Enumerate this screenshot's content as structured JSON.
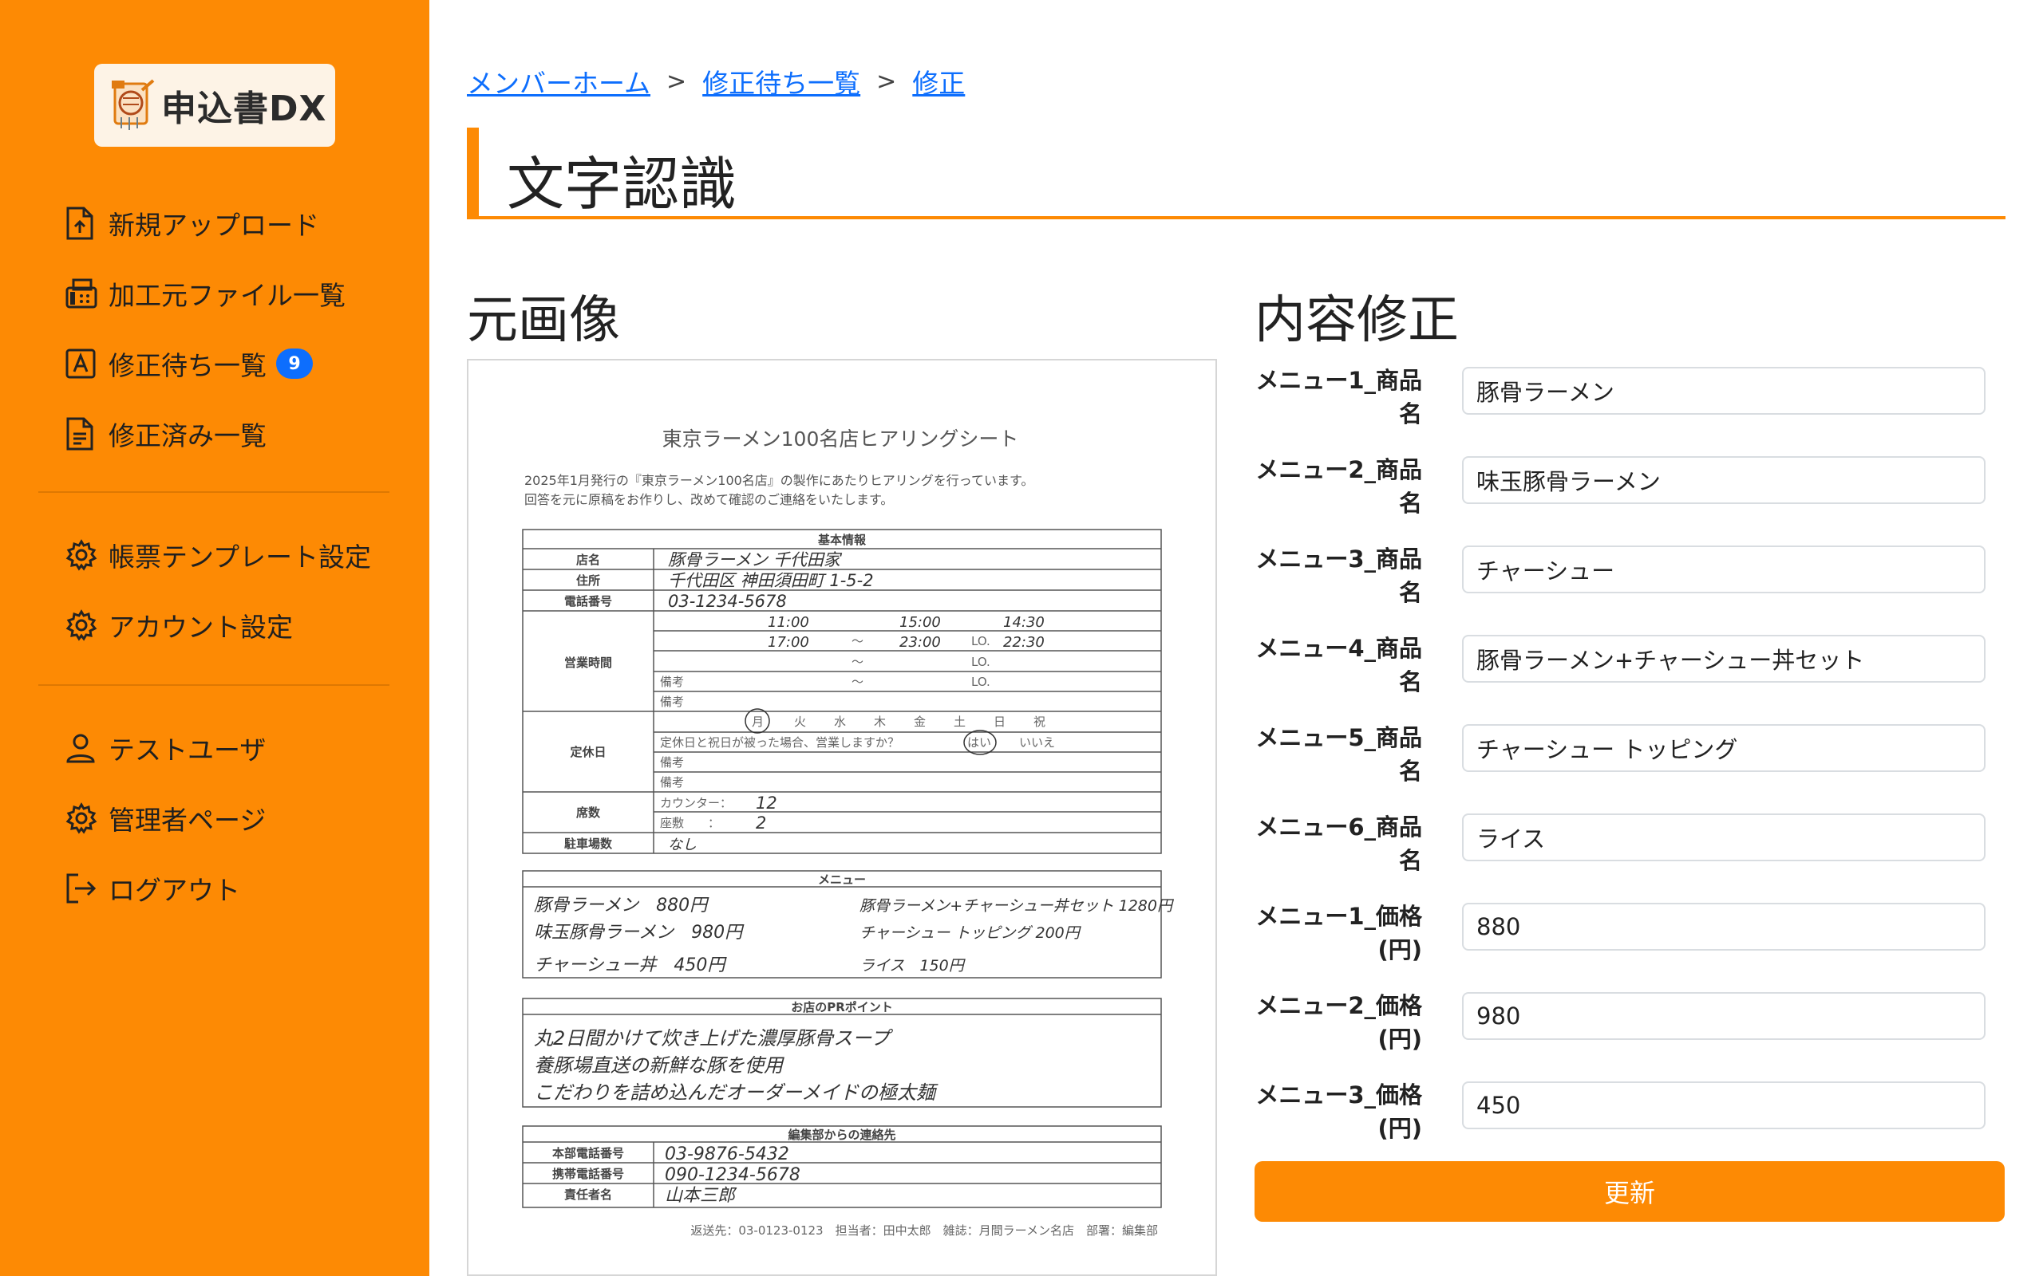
{
  "app": {
    "logo_text": "申込書DX"
  },
  "sidebar": {
    "items": [
      {
        "label": "新規アップロード",
        "icon": "file-upload-icon"
      },
      {
        "label": "加工元ファイル一覧",
        "icon": "fax-icon"
      },
      {
        "label": "修正待ち一覧",
        "icon": "letter-a-icon",
        "badge": "9"
      },
      {
        "label": "修正済み一覧",
        "icon": "file-text-icon"
      },
      {
        "label": "帳票テンプレート設定",
        "icon": "gear-icon"
      },
      {
        "label": "アカウント設定",
        "icon": "gear-icon"
      },
      {
        "label": "テストユーザ",
        "icon": "person-icon"
      },
      {
        "label": "管理者ページ",
        "icon": "gear-icon"
      },
      {
        "label": "ログアウト",
        "icon": "logout-icon"
      }
    ]
  },
  "breadcrumb": [
    {
      "label": "メンバーホーム"
    },
    {
      "label": "修正待ち一覧"
    },
    {
      "label": "修正"
    }
  ],
  "breadcrumb_separator": ">",
  "page_title": "文字認識",
  "left_section_title": "元画像",
  "right_section_title": "内容修正",
  "form": {
    "fields": [
      {
        "label": "メニュー1_商品名",
        "value": "豚骨ラーメン"
      },
      {
        "label": "メニュー2_商品名",
        "value": "味玉豚骨ラーメン"
      },
      {
        "label": "メニュー3_商品名",
        "value": "チャーシュー"
      },
      {
        "label": "メニュー4_商品名",
        "value": "豚骨ラーメン+チャーシュー丼セット"
      },
      {
        "label": "メニュー5_商品名",
        "value": "チャーシュー トッピング"
      },
      {
        "label": "メニュー6_商品名",
        "value": "ライス"
      },
      {
        "label": "メニュー1_価格(円)",
        "value": "880"
      },
      {
        "label": "メニュー2_価格(円)",
        "value": "980"
      },
      {
        "label": "メニュー3_価格(円)",
        "value": "450"
      }
    ],
    "submit_label": "更新"
  },
  "document": {
    "title": "東京ラーメン100名店ヒアリングシート",
    "intro_line1": "2025年1月発行の『東京ラーメン100名店』の製作にあたりヒアリングを行っています。",
    "intro_line2": "回答を元に原稿をお作りし、改めて確認のご連絡をいたします。",
    "basic_header": "基本情報",
    "labels": {
      "store_name": "店名",
      "address": "住所",
      "phone": "電話番号",
      "hours": "営業時間",
      "holiday": "定休日",
      "seats": "席数",
      "parking": "駐車場数",
      "remarks": "備考",
      "counter": "カウンター：",
      "table_seats": "座敷　　：",
      "holiday_question": "定休日と祝日が被った場合、営業しますか？",
      "yes": "はい",
      "no": "いいえ",
      "lo": "LO.",
      "tilde": "～"
    },
    "days": [
      "月",
      "火",
      "水",
      "木",
      "金",
      "土",
      "日",
      "祝"
    ],
    "handwritten": {
      "store_name": "豚骨ラーメン 千代田家",
      "address": "千代田区 神田須田町 1-5-2",
      "phone": "03-1234-5678",
      "hours1_open": "11:00",
      "hours1_close": "15:00",
      "hours1_lo": "14:30",
      "hours2_open": "17:00",
      "hours2_close": "23:00",
      "hours2_lo": "22:30",
      "counter": "12",
      "table_seats": "2",
      "parking": "なし"
    },
    "menu_header": "メニュー",
    "menu_lines": [
      "豚骨ラーメン　880円",
      "味玉豚骨ラーメン　980円",
      "チャーシュー丼　450円",
      "豚骨ラーメン+チャーシュー丼セット 1280円",
      "チャーシュー トッピング 200円",
      "ライス　150円"
    ],
    "pr_header": "お店のPRポイント",
    "pr_lines": [
      "丸2日間かけて炊き上げた濃厚豚骨スープ",
      "養豚場直送の新鮮な豚を使用",
      "こだわりを詰め込んだオーダーメイドの極太麺"
    ],
    "contact_header": "編集部からの連絡先",
    "contact_labels": [
      "本部電話番号",
      "携帯電話番号",
      "責任者名"
    ],
    "contact_values": [
      "03-9876-5432",
      "090-1234-5678",
      "山本三郎"
    ],
    "footer": "返送先：03-0123-0123　担当者：田中太郎　雑誌：月間ラーメン名店　部署：編集部"
  }
}
